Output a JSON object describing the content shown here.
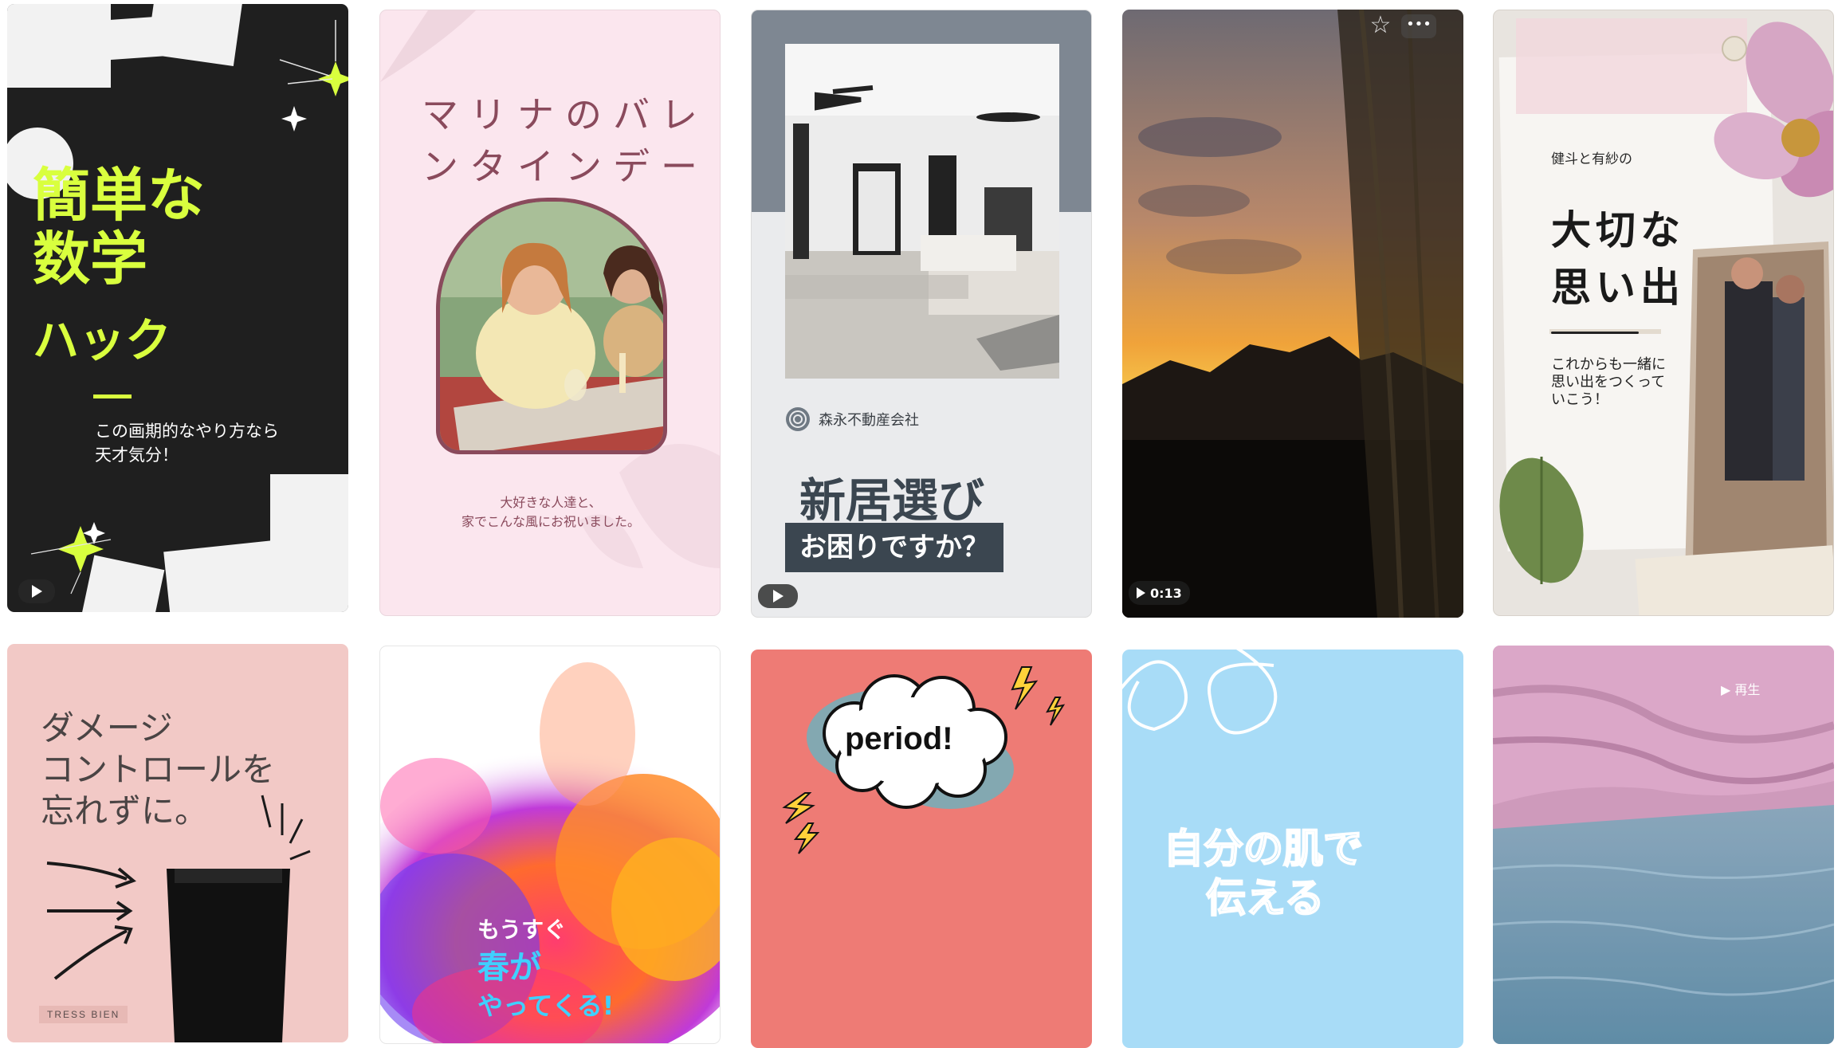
{
  "cards": {
    "c1": {
      "line1": "簡単な",
      "line2": "数学",
      "line3": "ハック",
      "sub1": "この画期的なやり方なら",
      "sub2": "天才気分！"
    },
    "c2": {
      "title1": "マリナのバレ",
      "title2": "ンタインデー",
      "sub1": "大好きな人達と、",
      "sub2": "家でこんな風にお祝いました。"
    },
    "c3": {
      "company": "森永不動産会社",
      "headline": "新居選び",
      "banner": "お困りですか？"
    },
    "c4": {
      "duration": "0:13"
    },
    "c5": {
      "small": "健斗と有紗の",
      "big1": "大切な",
      "big2": "思い出",
      "sub1": "これからも一緒に",
      "sub2": "思い出をつくって",
      "sub3": "いこう！"
    },
    "c6": {
      "line1": "ダメージ",
      "line2": "コントロールを",
      "line3": "忘れずに。",
      "brand": "TRESS BIEN"
    },
    "c7": {
      "line1": "もうすぐ",
      "line2": "春が",
      "line3": "やってくる!"
    },
    "c8": {
      "word": "period!"
    },
    "c9": {
      "line1": "自分の肌で",
      "line2": "伝える"
    },
    "c10": {
      "play": "▶ 再生"
    }
  },
  "colors": {
    "c1_bg": "#1f1f1f",
    "c1_accent": "#d9ff3e",
    "c2_bg": "#fbe6ee",
    "c2_title": "#8a4a5c",
    "c3_gray": "#7e8792",
    "c3_banner": "#3b4650",
    "c6_bg": "#f2c9c6",
    "c8_bg": "#ee7b75",
    "c9_bg": "#a8dcf7"
  },
  "icons": [
    "play-icon",
    "star-icon",
    "more-icon",
    "sparkle-icon",
    "spiral-logo-icon",
    "lightning-icon"
  ]
}
